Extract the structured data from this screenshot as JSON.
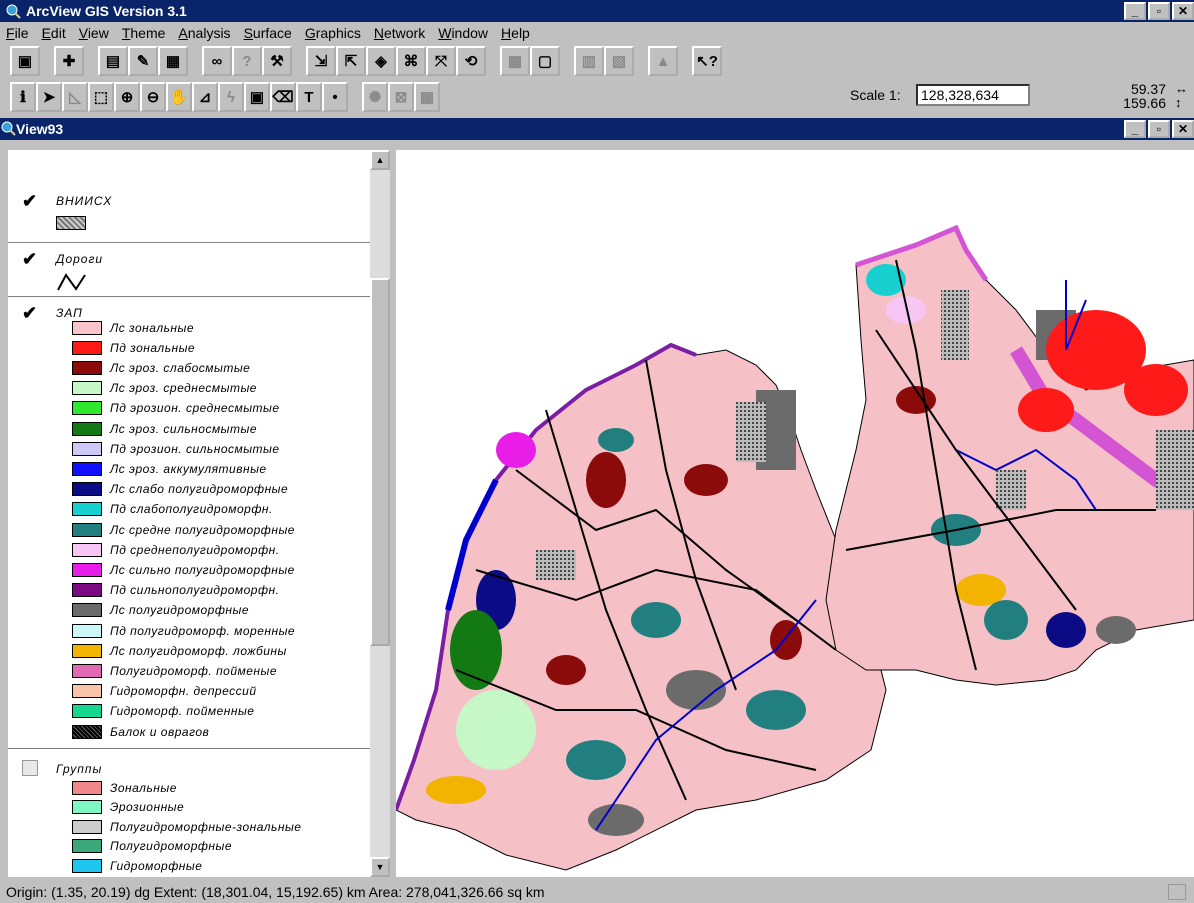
{
  "app": {
    "title": "ArcView GIS Version 3.1",
    "window_buttons": [
      "_",
      "▫",
      "✕"
    ]
  },
  "menu": [
    "File",
    "Edit",
    "View",
    "Theme",
    "Analysis",
    "Surface",
    "Graphics",
    "Network",
    "Window",
    "Help"
  ],
  "toolbar": {
    "scale_label": "Scale 1:",
    "scale_value": "128,328,634",
    "coord_x": "59.37",
    "coord_y": "159.66"
  },
  "view": {
    "title": "View93"
  },
  "toc": {
    "themes": [
      {
        "name": "ВНИИСХ",
        "checked": true
      },
      {
        "name": "Дороги",
        "checked": true
      },
      {
        "name": "ЗАП",
        "checked": true
      },
      {
        "name": "Группы",
        "checked": false
      }
    ],
    "zap_legend": [
      {
        "label": "Лс зональные",
        "color": "#f9c4c9"
      },
      {
        "label": "Пд зональные",
        "color": "#ff1a1a"
      },
      {
        "label": "Лс эроз. слабосмытые",
        "color": "#8b0a0a"
      },
      {
        "label": "Лс эроз. среднесмытые",
        "color": "#c6f7c6"
      },
      {
        "label": "Пд эрозион. среднесмытые",
        "color": "#2ee82e"
      },
      {
        "label": "Лс эроз. сильносмытые",
        "color": "#137a13"
      },
      {
        "label": "Пд эрозион. сильносмытые",
        "color": "#cdc8f5"
      },
      {
        "label": "Лс эроз. аккумулятивные",
        "color": "#1010ff"
      },
      {
        "label": "Лс слабо полугидроморфные",
        "color": "#0b0b85"
      },
      {
        "label": "Пд слабополугидроморфн.",
        "color": "#18d0d0"
      },
      {
        "label": "Лс средне полугидроморфные",
        "color": "#217f80"
      },
      {
        "label": "Пд среднеполугидроморфн.",
        "color": "#f7c6f5"
      },
      {
        "label": "Лс сильно полугидроморфные",
        "color": "#e81ee8"
      },
      {
        "label": "Пд сильнополугидроморфн.",
        "color": "#7d0a85"
      },
      {
        "label": "Лс полугидроморфные",
        "color": "#6b6b6b"
      },
      {
        "label": "Пд полугидроморф. моренные",
        "color": "#ccf6f7"
      },
      {
        "label": "Лс полугидроморф. ложбины",
        "color": "#f2b400"
      },
      {
        "label": "Полугидроморф. пойменые",
        "color": "#e06ab3"
      },
      {
        "label": "Гидроморфн. депрессий",
        "color": "#f9c4a8"
      },
      {
        "label": "Гидроморф. пойменные",
        "color": "#15d88e"
      },
      {
        "label": "Балок и оврагов",
        "color": "#111111"
      }
    ],
    "groups_legend": [
      {
        "label": "Зональные",
        "color": "#f08a8a"
      },
      {
        "label": "Эрозионные",
        "color": "#7ff7c4"
      },
      {
        "label": "Полугидроморфные-зональные",
        "color": "#cccccc"
      },
      {
        "label": "Полугидроморфные",
        "color": "#3aa879"
      },
      {
        "label": "Гидроморфные",
        "color": "#1ec6f0"
      }
    ]
  },
  "status": {
    "text": "Origin: (1.35, 20.19) dg  Extent: (18,301.04, 15,192.65) km  Area: 278,041,326.66 sq km"
  }
}
